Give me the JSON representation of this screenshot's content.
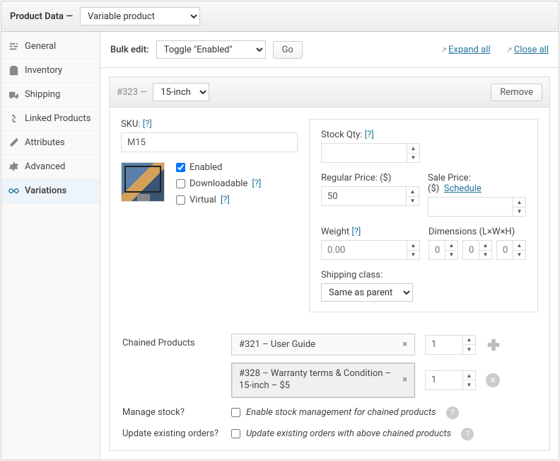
{
  "header": {
    "title": "Product Data —",
    "type": "Variable product"
  },
  "side": [
    {
      "k": "general",
      "l": "General"
    },
    {
      "k": "inventory",
      "l": "Inventory"
    },
    {
      "k": "shipping",
      "l": "Shipping"
    },
    {
      "k": "linked",
      "l": "Linked Products"
    },
    {
      "k": "attributes",
      "l": "Attributes"
    },
    {
      "k": "advanced",
      "l": "Advanced"
    },
    {
      "k": "variations",
      "l": "Variations"
    }
  ],
  "bulk": {
    "label": "Bulk edit:",
    "sel": "Toggle \"Enabled\"",
    "go": "Go",
    "expand": "Expand all",
    "close": "Close all"
  },
  "var": {
    "id": "#323 —",
    "size": "15-inch",
    "remove": "Remove",
    "sku_l": "SKU:",
    "sku": "M15",
    "enabled": "Enabled",
    "downloadable": "Downloadable",
    "virtual": "Virtual",
    "stock_l": "Stock Qty:",
    "stock": "",
    "reg_l": "Regular Price: ($)",
    "reg": "50",
    "sale_l": "Sale Price: ($)",
    "sched": "Schedule",
    "sale": "",
    "weight_l": "Weight",
    "weight_ph": "0.00",
    "dim_l": "Dimensions (L×W×H)",
    "dim_ph": "0",
    "shipc_l": "Shipping class:",
    "shipc": "Same as parent"
  },
  "cp": {
    "label": "Chained Products",
    "items": [
      {
        "t": "#321 – User Guide",
        "q": "1"
      },
      {
        "t": "#328 – Warranty terms & Condition – 15-inch – $5",
        "q": "1"
      }
    ],
    "ms_l": "Manage stock?",
    "ms_t": "Enable stock management for chained products",
    "uo_l": "Update existing orders?",
    "uo_t": "Update existing orders with above chained products"
  }
}
